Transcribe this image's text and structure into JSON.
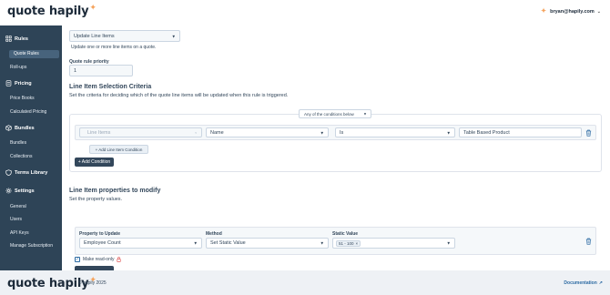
{
  "header": {
    "logo_text": "quote hapily",
    "user_email": "bryan@hapily.com"
  },
  "sidebar": {
    "sections": [
      {
        "label": "Rules",
        "icon": "rules-icon",
        "items": [
          "Quote Rules",
          "Roll-ups"
        ]
      },
      {
        "label": "Pricing",
        "icon": "pricing-icon",
        "items": [
          "Price Books",
          "Calculated Pricing"
        ]
      },
      {
        "label": "Bundles",
        "icon": "bundles-icon",
        "items": [
          "Bundles",
          "Collections"
        ]
      },
      {
        "label": "Terms Library",
        "icon": "terms-library-icon",
        "items": []
      },
      {
        "label": "Settings",
        "icon": "settings-icon",
        "items": [
          "General",
          "Users",
          "API Keys",
          "Manage Subscription"
        ]
      }
    ],
    "active_item": "Quote Rules"
  },
  "main": {
    "action_select": "Update Line Items",
    "action_desc": "Update one or more line items on a quote.",
    "priority_label": "Quote rule priority",
    "priority_value": "1",
    "criteria_title": "Line Item Selection Criteria",
    "criteria_desc": "Set the criteria for deciding which of the quote line items will be updated when this rule is triggered.",
    "conditions_mode": "Any of the conditions below",
    "condition": {
      "object_placeholder": "Line Items",
      "field": "Name",
      "operator": "Is",
      "value": "Table Based Product"
    },
    "add_line_item_condition": "+ Add Line Item Condition",
    "add_condition": "+ Add Condition",
    "props_title": "Line Item properties to modify",
    "props_desc": "Set the property values.",
    "property_headers": {
      "property": "Property to Update",
      "method": "Method",
      "value": "Static Value"
    },
    "property_row": {
      "property": "Employee Count",
      "method": "Set Static Value",
      "value_chip": "51 - 100"
    },
    "readonly_label": "Make read-only"
  },
  "footer": {
    "logo_text": "quote hapily",
    "copyright": "© hapily 2025",
    "documentation": "Documentation"
  },
  "colors": {
    "sidebar_bg": "#2e4457",
    "accent_orange": "#f5a25b",
    "link_blue": "#2d6ba3",
    "readonly_lock": "#e05a5a"
  }
}
